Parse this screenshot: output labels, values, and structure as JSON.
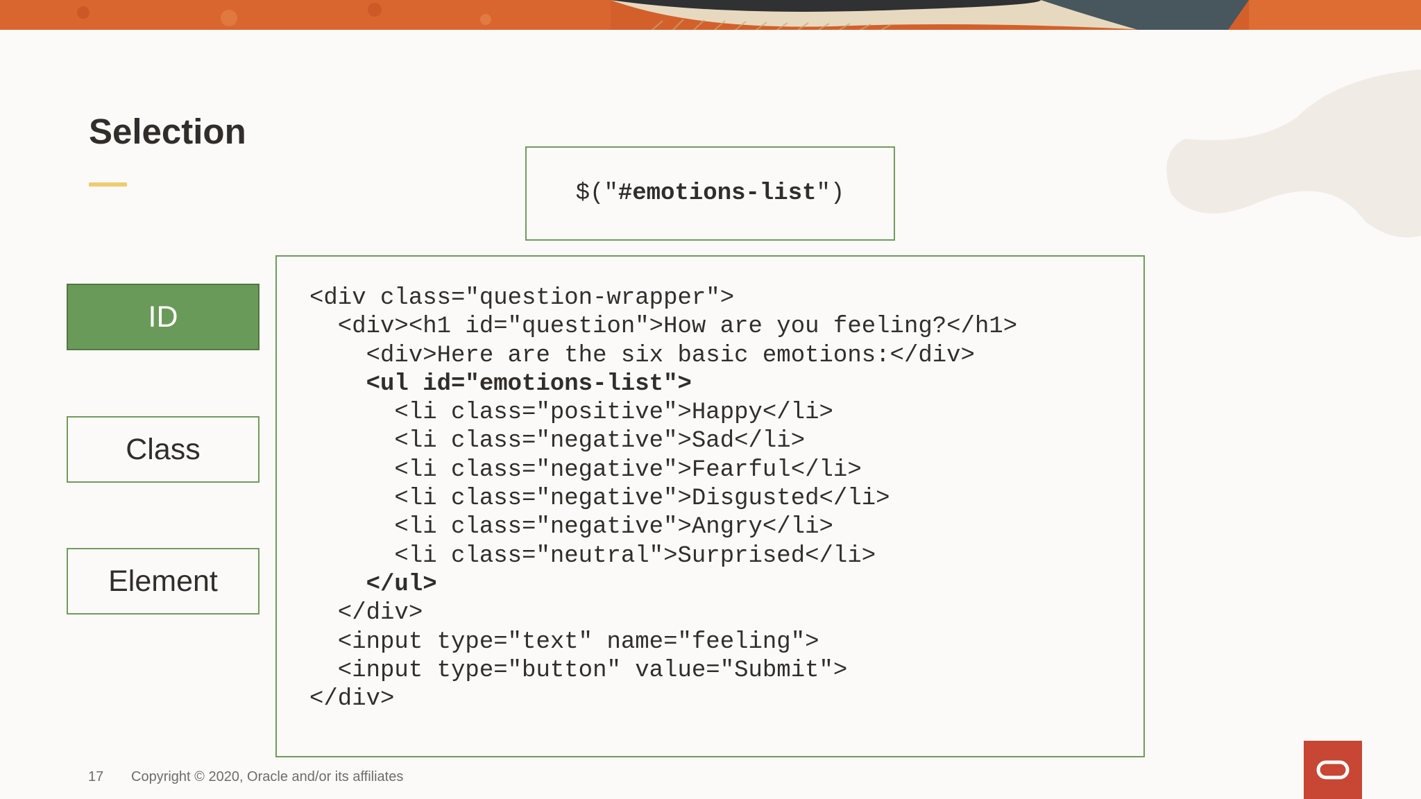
{
  "slide": {
    "title": "Selection",
    "selector": {
      "prefix": "$(\"",
      "highlight": "#emotions-list",
      "suffix": "\")"
    }
  },
  "selection_types": [
    {
      "label": "ID",
      "active": true
    },
    {
      "label": "Class",
      "active": false
    },
    {
      "label": "Element",
      "active": false
    }
  ],
  "code_lines": [
    {
      "text": "<div class=\"question-wrapper\">",
      "bold": false
    },
    {
      "text": "  <div><h1 id=\"question\">How are you feeling?</h1>",
      "bold": false
    },
    {
      "text": "    <div>Here are the six basic emotions:</div>",
      "bold": false
    },
    {
      "text": "    <ul id=\"emotions-list\">",
      "bold": true
    },
    {
      "text": "      <li class=\"positive\">Happy</li>",
      "bold": false
    },
    {
      "text": "      <li class=\"negative\">Sad</li>",
      "bold": false
    },
    {
      "text": "      <li class=\"negative\">Fearful</li>",
      "bold": false
    },
    {
      "text": "      <li class=\"negative\">Disgusted</li>",
      "bold": false
    },
    {
      "text": "      <li class=\"negative\">Angry</li>",
      "bold": false
    },
    {
      "text": "      <li class=\"neutral\">Surprised</li>",
      "bold": false
    },
    {
      "text": "    </ul>",
      "bold": true
    },
    {
      "text": "  </div>",
      "bold": false
    },
    {
      "text": "  <input type=\"text\" name=\"feeling\">",
      "bold": false
    },
    {
      "text": "  <input type=\"button\" value=\"Submit\">",
      "bold": false
    },
    {
      "text": "</div>",
      "bold": false
    }
  ],
  "footer": {
    "page_number": "17",
    "copyright": "Copyright © 2020, Oracle and/or its affiliates"
  },
  "colors": {
    "active_button": "#6a9a59",
    "border_green": "#6f9b5d",
    "title_accent": "#f0cc71",
    "brand_red": "#c74634"
  },
  "icons": [
    "oracle-logo-icon"
  ]
}
